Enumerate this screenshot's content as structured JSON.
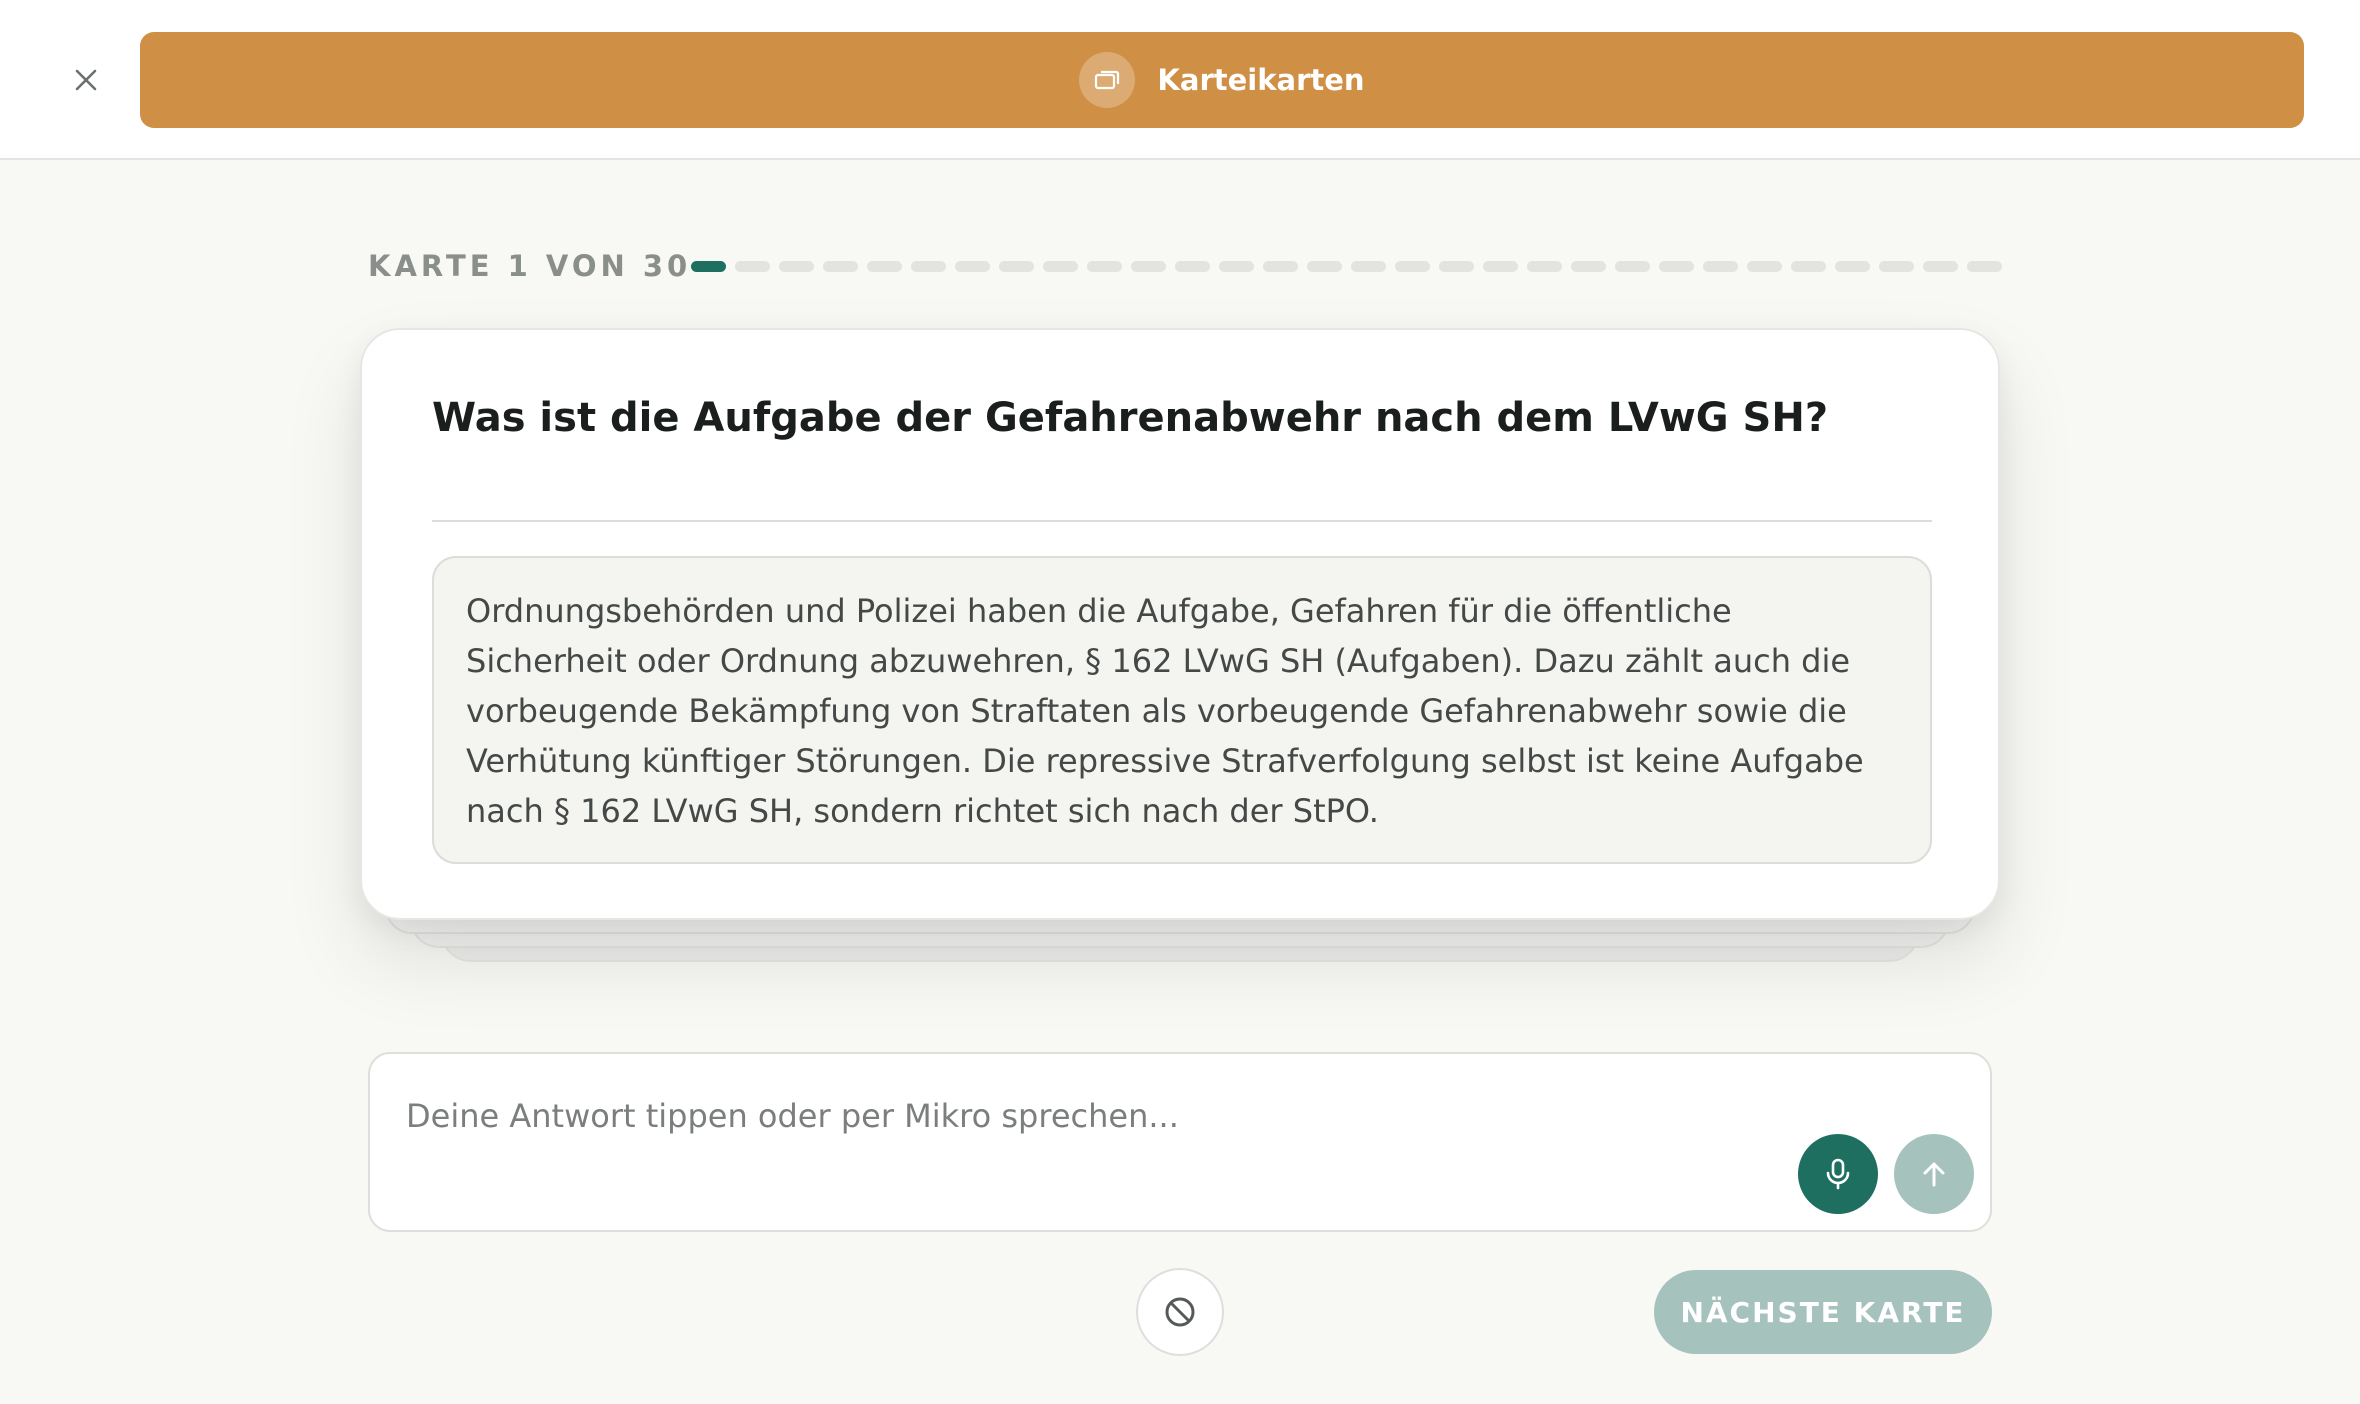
{
  "header": {
    "title": "Karteikarten",
    "icon": "cards-icon",
    "close_icon": "close-icon",
    "color": "#cf8f44"
  },
  "progress": {
    "label": "KARTE 1 VON 30",
    "current": 1,
    "total": 30,
    "active_color": "#1e6f60"
  },
  "card": {
    "question": "Was ist die Aufgabe der Gefahrenabwehr nach dem LVwG SH?",
    "answer": "Ordnungsbehörden und Polizei haben die Aufgabe, Gefahren für die öffentliche Sicherheit oder Ordnung abzuwehren, § 162 LVwG SH (Aufgaben). Dazu zählt auch die vorbeugende Bekämpfung von Straftaten als vorbeugende Gefahrenabwehr sowie die Verhütung künftiger Störungen. Die repressive Strafverfolgung selbst ist keine Aufgabe nach § 162 LVwG SH, sondern richtet sich nach der StPO."
  },
  "input": {
    "placeholder": "Deine Antwort tippen oder per Mikro sprechen...",
    "value": "",
    "mic_icon": "microphone-icon",
    "send_icon": "arrow-up-icon"
  },
  "actions": {
    "skip_icon": "block-icon",
    "next_label": "NÄCHSTE KARTE"
  }
}
